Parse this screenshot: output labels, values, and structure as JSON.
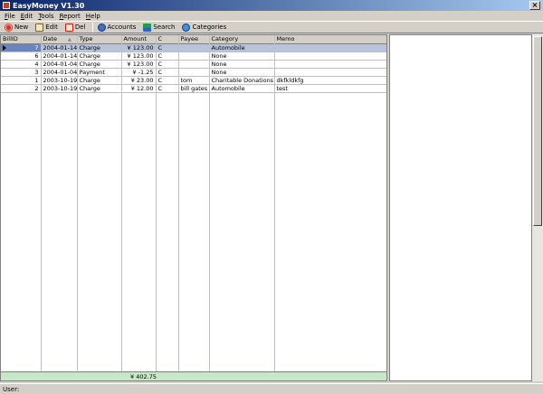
{
  "window": {
    "title": "EasyMoney V1.30",
    "close_label": "×"
  },
  "menu": [
    {
      "label": "File",
      "ul": "F",
      "rest": "ile"
    },
    {
      "label": "Edit",
      "ul": "E",
      "rest": "dit"
    },
    {
      "label": "Tools",
      "ul": "T",
      "rest": "ools"
    },
    {
      "label": "Report",
      "ul": "R",
      "rest": "eport"
    },
    {
      "label": "Help",
      "ul": "H",
      "rest": "elp"
    }
  ],
  "toolbar": {
    "new_label": "New",
    "edit_label": "Edit",
    "del_label": "Del",
    "accounts_label": "Accounts",
    "search_label": "Search",
    "categories_label": "Categories"
  },
  "grid": {
    "columns": [
      "BillID",
      "Date",
      "Type",
      "Amount",
      "C",
      "Payee",
      "Category",
      "Memo"
    ],
    "rows": [
      {
        "id": "7",
        "date": "2004-01-14",
        "type": "Charge",
        "amount": "¥ 123.00",
        "c": "C",
        "payee": "",
        "category": "Automobile",
        "memo": "",
        "selected": true
      },
      {
        "id": "6",
        "date": "2004-01-14",
        "type": "Charge",
        "amount": "¥ 123.00",
        "c": "C",
        "payee": "",
        "category": "None",
        "memo": ""
      },
      {
        "id": "4",
        "date": "2004-01-04",
        "type": "Charge",
        "amount": "¥ 123.00",
        "c": "C",
        "payee": "",
        "category": "None",
        "memo": ""
      },
      {
        "id": "3",
        "date": "2004-01-04",
        "type": "Payment",
        "amount": "¥ -1.25",
        "c": "C",
        "payee": "",
        "category": "None",
        "memo": ""
      },
      {
        "id": "1",
        "date": "2003-10-19",
        "type": "Charge",
        "amount": "¥ 23.00",
        "c": "C",
        "payee": "tom",
        "category": "Charitable Donations",
        "memo": "dkfkldkfg"
      },
      {
        "id": "2",
        "date": "2003-10-19",
        "type": "Charge",
        "amount": "¥ 12.00",
        "c": "C",
        "payee": "bill gates",
        "category": "Automobile",
        "memo": "test"
      }
    ],
    "total": "¥ 402.75",
    "sort_indicator": "▲"
  },
  "status": {
    "label": "User:"
  }
}
